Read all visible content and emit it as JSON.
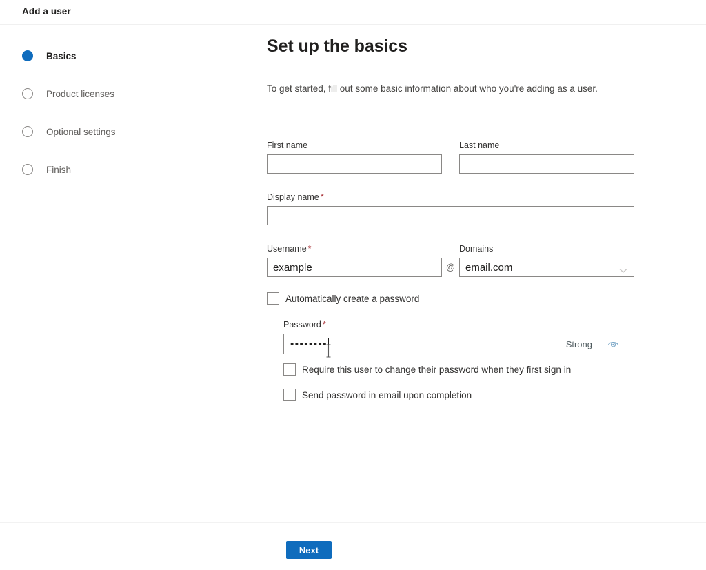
{
  "window": {
    "title": "Add a user"
  },
  "sidebar": {
    "steps": [
      {
        "label": "Basics",
        "state": "active"
      },
      {
        "label": "Product licenses",
        "state": "inactive"
      },
      {
        "label": "Optional settings",
        "state": "inactive"
      },
      {
        "label": "Finish",
        "state": "inactive"
      }
    ]
  },
  "main": {
    "title": "Set up the basics",
    "subtitle": "To get started, fill out some basic information about who you're adding as a user.",
    "fields": {
      "first_name": {
        "label": "First name",
        "value": "",
        "required": false
      },
      "last_name": {
        "label": "Last name",
        "value": "",
        "required": false
      },
      "display_name": {
        "label": "Display name",
        "value": "",
        "required": true,
        "required_mark": "*"
      },
      "username": {
        "label": "Username",
        "value": "example",
        "required": true,
        "required_mark": "*"
      },
      "at_separator": "@",
      "domains": {
        "label": "Domains",
        "value": "email.com",
        "options": [
          "email.com"
        ]
      },
      "password": {
        "label": "Password",
        "required": true,
        "required_mark": "*",
        "masked_value": "••••••••",
        "strength": "Strong"
      }
    },
    "checkboxes": {
      "auto_password": {
        "label": "Automatically create a password",
        "checked": false
      },
      "require_change": {
        "label": "Require this user to change their password when they first sign in",
        "checked": false
      },
      "send_email": {
        "label": "Send password in email upon completion",
        "checked": false
      }
    },
    "icons": {
      "chevron_down": "chevron-down-icon",
      "eye": "eye-reveal-password-icon"
    }
  },
  "footer": {
    "next_label": "Next"
  },
  "colors": {
    "accent": "#0f6cbd",
    "required_asterisk": "#a4262c",
    "border": "#8a8886",
    "text_primary": "#201f1e",
    "text_secondary": "#605e5c",
    "eye_icon": "#7aa7c7"
  }
}
